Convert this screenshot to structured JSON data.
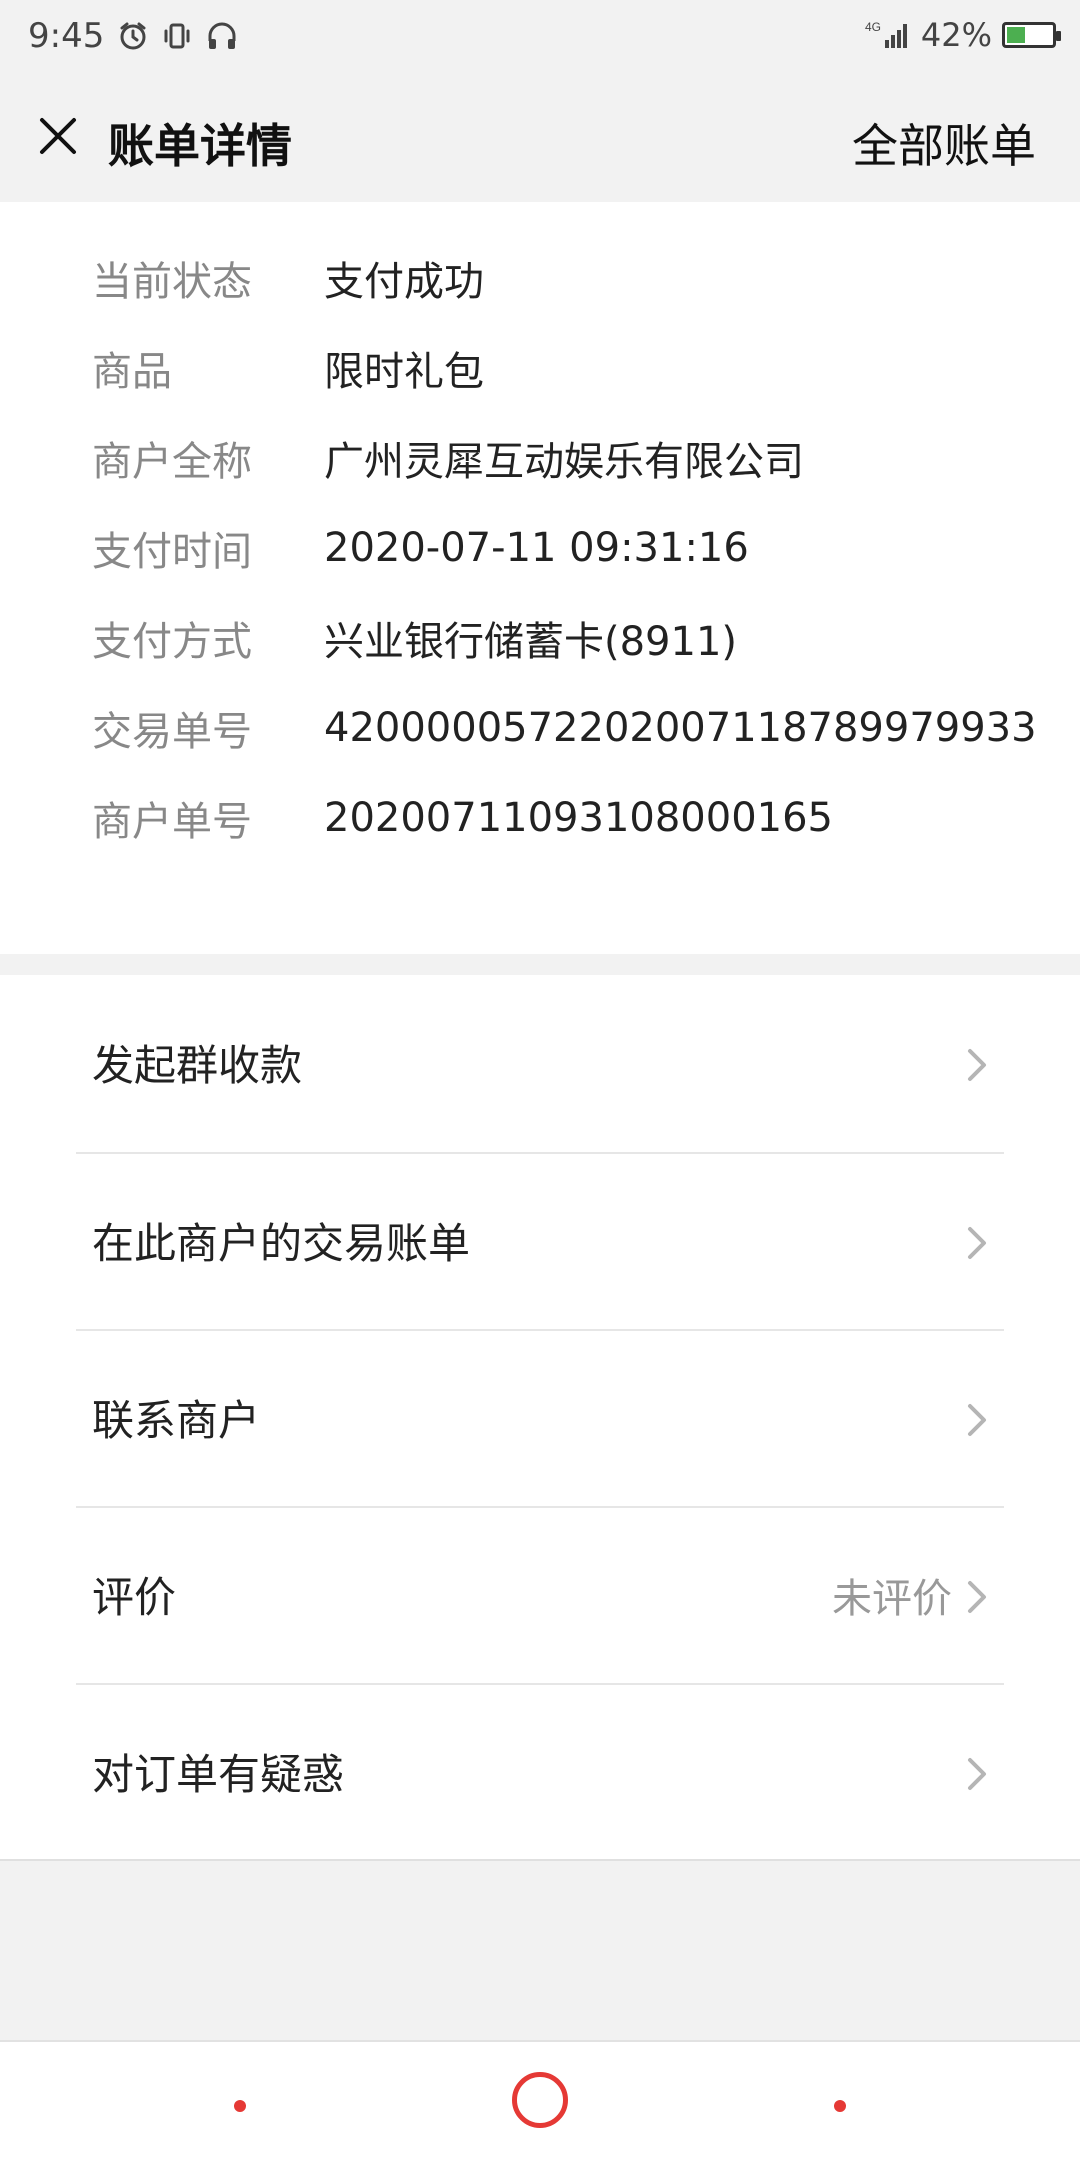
{
  "status_bar": {
    "time": "9:45",
    "network": "4G",
    "battery_percent": "42%",
    "battery_level": 0.42,
    "icons": [
      "alarm-icon",
      "vibrate-icon",
      "headphones-icon",
      "signal-icon",
      "battery-icon"
    ]
  },
  "header": {
    "title": "账单详情",
    "right_action": "全部账单"
  },
  "details": [
    {
      "label": "当前状态",
      "value": "支付成功"
    },
    {
      "label": "商品",
      "value": "限时礼包"
    },
    {
      "label": "商户全称",
      "value": "广州灵犀互动娱乐有限公司"
    },
    {
      "label": "支付时间",
      "value": "2020-07-11 09:31:16"
    },
    {
      "label": "支付方式",
      "value": "兴业银行储蓄卡(8911)"
    },
    {
      "label": "交易单号",
      "value": "4200000572202007118789979933"
    },
    {
      "label": "商户单号",
      "value": "20200711093108000165"
    }
  ],
  "actions": [
    {
      "label": "发起群收款",
      "value": ""
    },
    {
      "label": "在此商户的交易账单",
      "value": ""
    },
    {
      "label": "联系商户",
      "value": ""
    },
    {
      "label": "评价",
      "value": "未评价"
    },
    {
      "label": "对订单有疑惑",
      "value": ""
    }
  ],
  "colors": {
    "background": "#f2f2f2",
    "card": "#ffffff",
    "label_gray": "#888888",
    "system_nav_accent": "#e53935",
    "battery_green": "#4caf50"
  }
}
